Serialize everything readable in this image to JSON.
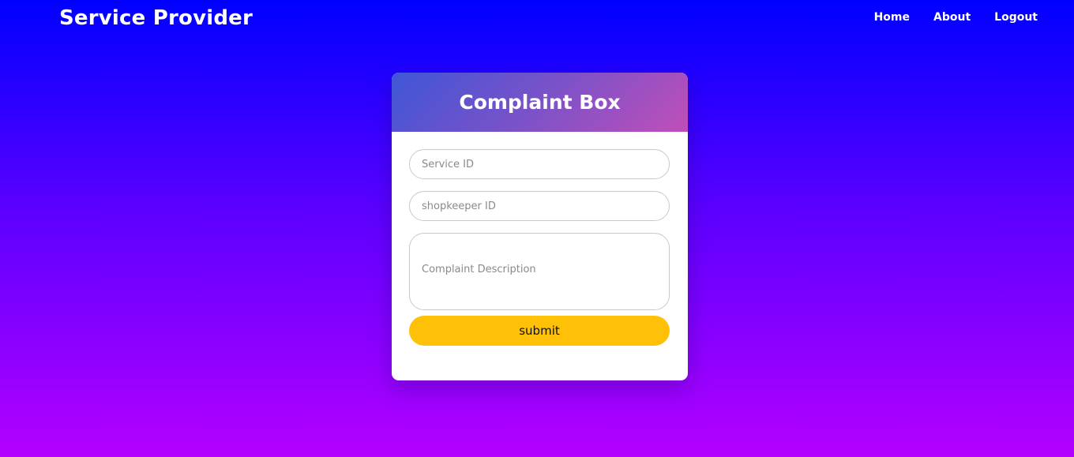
{
  "navbar": {
    "brand": "Service Provider",
    "links": [
      {
        "label": "Home"
      },
      {
        "label": "About"
      },
      {
        "label": "Logout"
      }
    ]
  },
  "complaint_form": {
    "title": "Complaint Box",
    "service_id": {
      "value": "",
      "placeholder": "Service ID"
    },
    "shopkeeper_id": {
      "value": "",
      "placeholder": "shopkeeper ID"
    },
    "description": {
      "value": "",
      "placeholder": "Complaint Description"
    },
    "submit_label": "submit"
  },
  "colors": {
    "background_top": "#0000ff",
    "background_bottom": "#b400ff",
    "header_gradient_start": "#3f56d6",
    "header_gradient_end": "#bf4fb9",
    "submit_button": "#ffc107"
  }
}
